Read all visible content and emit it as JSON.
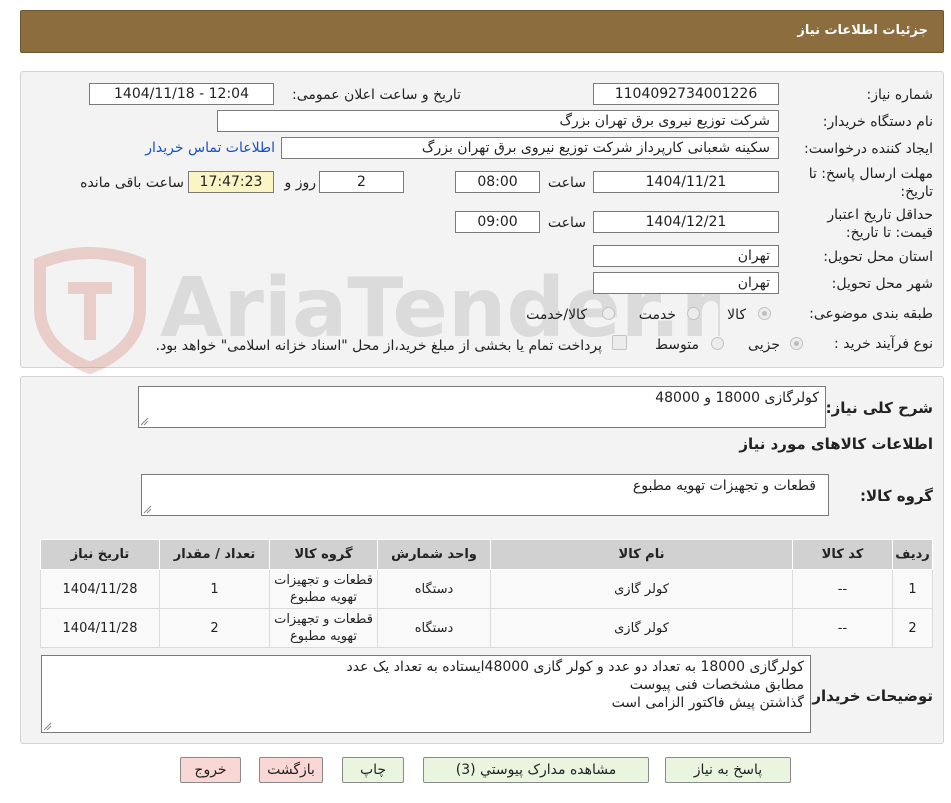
{
  "header": {
    "title": "جزئیات اطلاعات نیاز"
  },
  "watermark": {
    "text": "AriaTender.neT"
  },
  "form": {
    "need_number_label": "شماره نیاز:",
    "need_number": "1104092734001226",
    "announce_label": "تاریخ و ساعت اعلان عمومی:",
    "announce_value": "1404/11/18 - 12:04",
    "buyer_label": "نام دستگاه خریدار:",
    "buyer_value": "شرکت توزیع نیروی برق تهران بزرگ",
    "creator_label": "ایجاد کننده درخواست:",
    "creator_value": "سکینه شعبانی کارپرداز شرکت توزیع نیروی برق تهران بزرگ",
    "contact_link": "اطلاعات تماس خریدار",
    "deadline_label_1": "مهلت ارسال پاسخ: تا",
    "deadline_label_2": "تاریخ:",
    "deadline_date": "1404/11/21",
    "time_label": "ساعت",
    "deadline_time": "08:00",
    "days_value": "2",
    "days_label": "روز و",
    "remaining_time": "17:47:23",
    "remaining_label": "ساعت باقی مانده",
    "validity_label_1": "حداقل تاریخ اعتبار",
    "validity_label_2": "قیمت: تا تاریخ:",
    "validity_date": "1404/12/21",
    "validity_time": "09:00",
    "province_label": "استان محل تحویل:",
    "province_value": "تهران",
    "city_label": "شهر محل تحویل:",
    "city_value": "تهران",
    "category_label": "طبقه بندی موضوعی:",
    "category_options": [
      "کالا",
      "خدمت",
      "کالا/خدمت"
    ],
    "process_label": "نوع فرآیند خرید :",
    "process_options": [
      "جزیی",
      "متوسط"
    ],
    "payment_note": "پرداخت تمام یا بخشی از مبلغ خرید،از محل \"اسناد خزانه اسلامی\" خواهد بود."
  },
  "details": {
    "summary_label": "شرح کلی نیاز:",
    "summary_value": "کولرگازی 18000 و 48000",
    "goods_info_title": "اطلاعات کالاهای مورد نیاز",
    "goods_group_label": "گروه کالا:",
    "goods_group_value": "قطعات و تجهیزات تهویه مطبوع",
    "table": {
      "headers": [
        "ردیف",
        "کد کالا",
        "نام کالا",
        "واحد شمارش",
        "گروه کالا",
        "تعداد / مقدار",
        "تاریخ نیاز"
      ],
      "rows": [
        [
          "1",
          "--",
          "کولر گازی",
          "دستگاه",
          "قطعات و تجهیزات تهویه مطبوع",
          "1",
          "1404/11/28"
        ],
        [
          "2",
          "--",
          "کولر گازی",
          "دستگاه",
          "قطعات و تجهیزات تهویه مطبوع",
          "2",
          "1404/11/28"
        ]
      ]
    },
    "buyer_notes_label": "توضیحات خریدار:",
    "buyer_notes_lines": [
      "کولرگازی 18000 به تعداد دو عدد و کولر گازی 48000ایستاده به تعداد یک عدد",
      "مطابق مشخصات فنی پیوست",
      "گذاشتن پیش فاکتور الزامی است"
    ]
  },
  "buttons": {
    "reply": "پاسخ به نیاز",
    "attachments": "مشاهده مدارک پیوستي (3)",
    "print": "چاپ",
    "back": "بازگشت",
    "exit": "خروج"
  }
}
